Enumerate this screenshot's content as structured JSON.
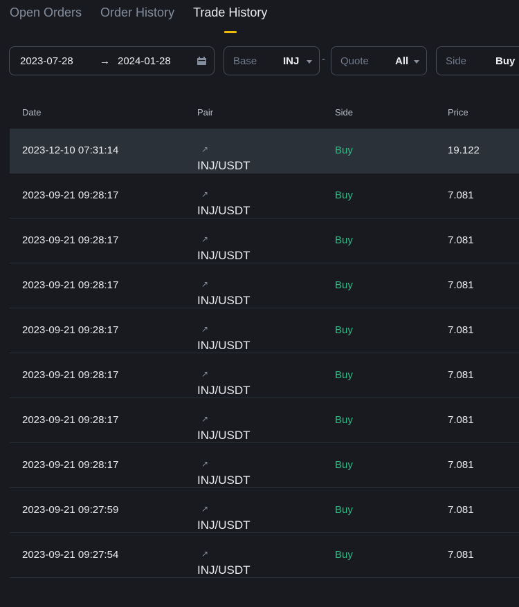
{
  "tabs": [
    {
      "label": "Open Orders",
      "active": false
    },
    {
      "label": "Order History",
      "active": false
    },
    {
      "label": "Trade History",
      "active": true
    }
  ],
  "filters": {
    "date_from": "2023-07-28",
    "date_arrow": "→",
    "date_to": "2024-01-28",
    "base_label": "Base",
    "base_value": "INJ",
    "separator": "-",
    "quote_label": "Quote",
    "quote_value": "All",
    "side_label": "Side",
    "side_value": "Buy"
  },
  "table": {
    "columns": [
      "Date",
      "Pair",
      "Side",
      "Price"
    ],
    "rows": [
      {
        "date": "2023-12-10 07:31:14",
        "pair": "INJ/USDT",
        "side": "Buy",
        "price": "19.122"
      },
      {
        "date": "2023-09-21 09:28:17",
        "pair": "INJ/USDT",
        "side": "Buy",
        "price": "7.081"
      },
      {
        "date": "2023-09-21 09:28:17",
        "pair": "INJ/USDT",
        "side": "Buy",
        "price": "7.081"
      },
      {
        "date": "2023-09-21 09:28:17",
        "pair": "INJ/USDT",
        "side": "Buy",
        "price": "7.081"
      },
      {
        "date": "2023-09-21 09:28:17",
        "pair": "INJ/USDT",
        "side": "Buy",
        "price": "7.081"
      },
      {
        "date": "2023-09-21 09:28:17",
        "pair": "INJ/USDT",
        "side": "Buy",
        "price": "7.081"
      },
      {
        "date": "2023-09-21 09:28:17",
        "pair": "INJ/USDT",
        "side": "Buy",
        "price": "7.081"
      },
      {
        "date": "2023-09-21 09:28:17",
        "pair": "INJ/USDT",
        "side": "Buy",
        "price": "7.081"
      },
      {
        "date": "2023-09-21 09:27:59",
        "pair": "INJ/USDT",
        "side": "Buy",
        "price": "7.081"
      },
      {
        "date": "2023-09-21 09:27:54",
        "pair": "INJ/USDT",
        "side": "Buy",
        "price": "7.081"
      }
    ]
  },
  "icons": {
    "external_link": "↗",
    "calendar": "calendar-icon",
    "dropdown": "caret-down-icon"
  },
  "colors": {
    "background": "#181a20",
    "accent": "#f0b90b",
    "buy": "#2ebd85",
    "row_highlight": "#2b3139"
  }
}
